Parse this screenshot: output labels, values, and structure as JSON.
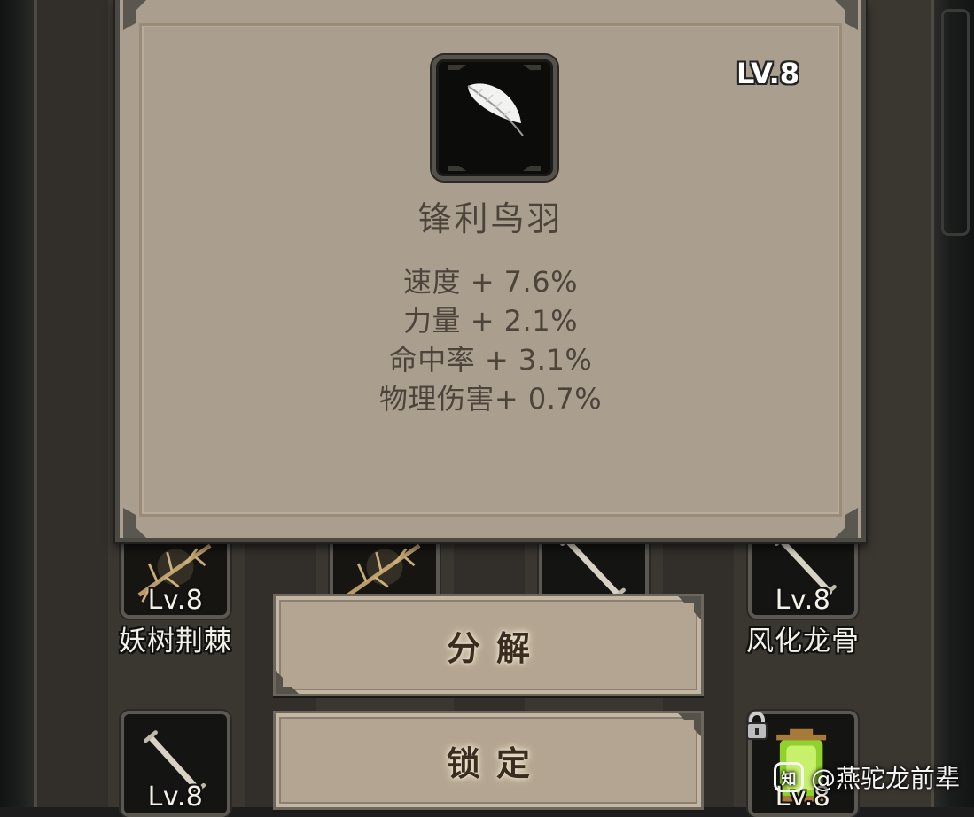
{
  "tooltip": {
    "item_name": "锋利鸟羽",
    "level": "LV.8",
    "stats": [
      "速度 + 7.6%",
      "力量 + 2.1%",
      "命中率 + 3.1%",
      "物理伤害+ 0.7%"
    ]
  },
  "slots": [
    {
      "level": "Lv.8",
      "name": "妖树荆棘"
    },
    {
      "level": "Lv.8",
      "name": "风化龙骨"
    },
    {
      "level": "Lv.8"
    },
    {
      "level": "Lv.8"
    }
  ],
  "actions": {
    "decompose_label": "分解",
    "lock_label": "锁定"
  },
  "watermark": {
    "text": "@燕驼龙前辈",
    "logo_text": "知"
  },
  "colors": {
    "card_background": "#aa9f8f",
    "button_background": "#b3a591",
    "text_dark": "#4c443b"
  }
}
